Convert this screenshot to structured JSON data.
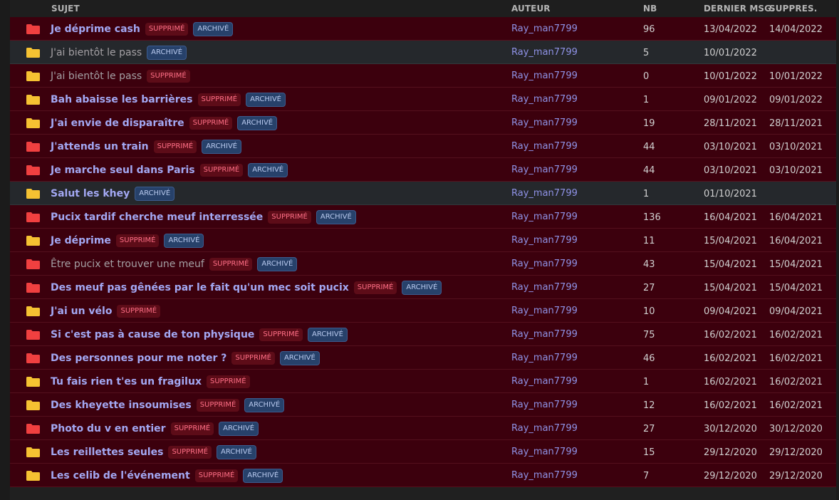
{
  "headers": {
    "subject": "SUJET",
    "author": "AUTEUR",
    "nb": "NB",
    "last_msg": "DERNIER MSG.",
    "deleted": "SUPPRES."
  },
  "colors": {
    "folder_red": "#f04040",
    "folder_yellow": "#f5c232",
    "row_deleted": "#3c000d",
    "row_normal": "#25282c",
    "title_link": "#a3a8f3",
    "badge_deleted": "#ff6f86",
    "badge_archived": "#b8c9ee"
  },
  "badge_labels": {
    "deleted": "SUPPRIMÉ",
    "archived": "ARCHIVÉ"
  },
  "rows": [
    {
      "title": "Je déprime cash",
      "folder": "red",
      "deleted": true,
      "archived": true,
      "author": "Ray_man7799",
      "nb": "96",
      "last": "13/04/2022",
      "del": "14/04/2022"
    },
    {
      "title": "J'ai bientôt le pass",
      "folder": "yellow",
      "deleted": false,
      "archived": true,
      "author": "Ray_man7799",
      "nb": "5",
      "last": "10/01/2022",
      "del": "",
      "dim": true
    },
    {
      "title": "J'ai bientôt le pass",
      "folder": "yellow",
      "deleted": true,
      "archived": false,
      "author": "Ray_man7799",
      "nb": "0",
      "last": "10/01/2022",
      "del": "10/01/2022",
      "dim": true
    },
    {
      "title": "Bah abaisse les barrières",
      "folder": "yellow",
      "deleted": true,
      "archived": true,
      "author": "Ray_man7799",
      "nb": "1",
      "last": "09/01/2022",
      "del": "09/01/2022"
    },
    {
      "title": "J'ai envie de disparaître",
      "folder": "yellow",
      "deleted": true,
      "archived": true,
      "author": "Ray_man7799",
      "nb": "19",
      "last": "28/11/2021",
      "del": "28/11/2021"
    },
    {
      "title": "J'attends un train",
      "folder": "red",
      "deleted": true,
      "archived": true,
      "author": "Ray_man7799",
      "nb": "44",
      "last": "03/10/2021",
      "del": "03/10/2021"
    },
    {
      "title": "Je marche seul dans Paris",
      "folder": "red",
      "deleted": true,
      "archived": true,
      "author": "Ray_man7799",
      "nb": "44",
      "last": "03/10/2021",
      "del": "03/10/2021"
    },
    {
      "title": "Salut les khey",
      "folder": "yellow",
      "deleted": false,
      "archived": true,
      "author": "Ray_man7799",
      "nb": "1",
      "last": "01/10/2021",
      "del": ""
    },
    {
      "title": "Pucix tardif cherche meuf interressée",
      "folder": "red",
      "deleted": true,
      "archived": true,
      "author": "Ray_man7799",
      "nb": "136",
      "last": "16/04/2021",
      "del": "16/04/2021"
    },
    {
      "title": "Je déprime",
      "folder": "yellow",
      "deleted": true,
      "archived": true,
      "author": "Ray_man7799",
      "nb": "11",
      "last": "15/04/2021",
      "del": "16/04/2021"
    },
    {
      "title": "Être pucix et trouver une meuf",
      "folder": "red",
      "deleted": true,
      "archived": true,
      "author": "Ray_man7799",
      "nb": "43",
      "last": "15/04/2021",
      "del": "15/04/2021",
      "dim": true
    },
    {
      "title": "Des meuf pas gênées par le fait qu'un mec soit pucix",
      "folder": "red",
      "deleted": true,
      "archived": true,
      "author": "Ray_man7799",
      "nb": "27",
      "last": "15/04/2021",
      "del": "15/04/2021"
    },
    {
      "title": "J'ai un vélo",
      "folder": "yellow",
      "deleted": true,
      "archived": false,
      "author": "Ray_man7799",
      "nb": "10",
      "last": "09/04/2021",
      "del": "09/04/2021"
    },
    {
      "title": "Si c'est pas à cause de ton physique",
      "folder": "red",
      "deleted": true,
      "archived": true,
      "author": "Ray_man7799",
      "nb": "75",
      "last": "16/02/2021",
      "del": "16/02/2021"
    },
    {
      "title": "Des personnes pour me noter ?",
      "folder": "red",
      "deleted": true,
      "archived": true,
      "author": "Ray_man7799",
      "nb": "46",
      "last": "16/02/2021",
      "del": "16/02/2021"
    },
    {
      "title": "Tu fais rien t'es un fragilux",
      "folder": "yellow",
      "deleted": true,
      "archived": false,
      "author": "Ray_man7799",
      "nb": "1",
      "last": "16/02/2021",
      "del": "16/02/2021"
    },
    {
      "title": "Des kheyette insoumises",
      "folder": "yellow",
      "deleted": true,
      "archived": true,
      "author": "Ray_man7799",
      "nb": "12",
      "last": "16/02/2021",
      "del": "16/02/2021"
    },
    {
      "title": "Photo du v en entier",
      "folder": "red",
      "deleted": true,
      "archived": true,
      "author": "Ray_man7799",
      "nb": "27",
      "last": "30/12/2020",
      "del": "30/12/2020"
    },
    {
      "title": "Les reillettes seules",
      "folder": "yellow",
      "deleted": true,
      "archived": true,
      "author": "Ray_man7799",
      "nb": "15",
      "last": "29/12/2020",
      "del": "29/12/2020"
    },
    {
      "title": "Les celib de l'événement",
      "folder": "yellow",
      "deleted": true,
      "archived": true,
      "author": "Ray_man7799",
      "nb": "7",
      "last": "29/12/2020",
      "del": "29/12/2020"
    }
  ]
}
